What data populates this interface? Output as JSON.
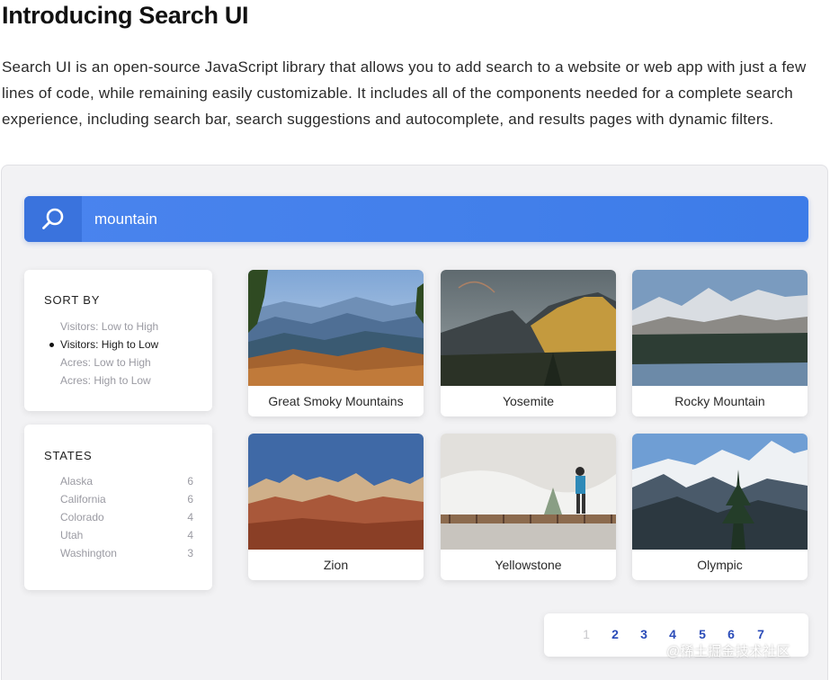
{
  "heading": "Introducing Search UI",
  "intro_text": "Search UI is an open-source JavaScript library that allows you to add search to a website or web app with just a few lines of code, while remaining easily customizable. It includes all of the components needed for a complete search experience, including search bar, search suggestions and autocomplete, and results pages with dynamic filters.",
  "search": {
    "value": "mountain",
    "icon": "search-icon",
    "bar_color": "#4580ec"
  },
  "sort": {
    "title": "SORT BY",
    "options": [
      {
        "label": "Visitors: Low to High",
        "selected": false
      },
      {
        "label": "Visitors: High to Low",
        "selected": true
      },
      {
        "label": "Acres: Low to High",
        "selected": false
      },
      {
        "label": "Acres: High to Low",
        "selected": false
      }
    ]
  },
  "states": {
    "title": "STATES",
    "facets": [
      {
        "name": "Alaska",
        "count": "6"
      },
      {
        "name": "California",
        "count": "6"
      },
      {
        "name": "Colorado",
        "count": "4"
      },
      {
        "name": "Utah",
        "count": "4"
      },
      {
        "name": "Washington",
        "count": "3"
      }
    ]
  },
  "results": [
    {
      "name": "Great Smoky Mountains"
    },
    {
      "name": "Yosemite"
    },
    {
      "name": "Rocky Mountain"
    },
    {
      "name": "Zion"
    },
    {
      "name": "Yellowstone"
    },
    {
      "name": "Olympic"
    }
  ],
  "pagination": {
    "pages": [
      "1",
      "2",
      "3",
      "4",
      "5",
      "6",
      "7"
    ],
    "current": "1",
    "link_color": "#2a4bb8"
  },
  "watermark": "@稀土掘金技术社区"
}
